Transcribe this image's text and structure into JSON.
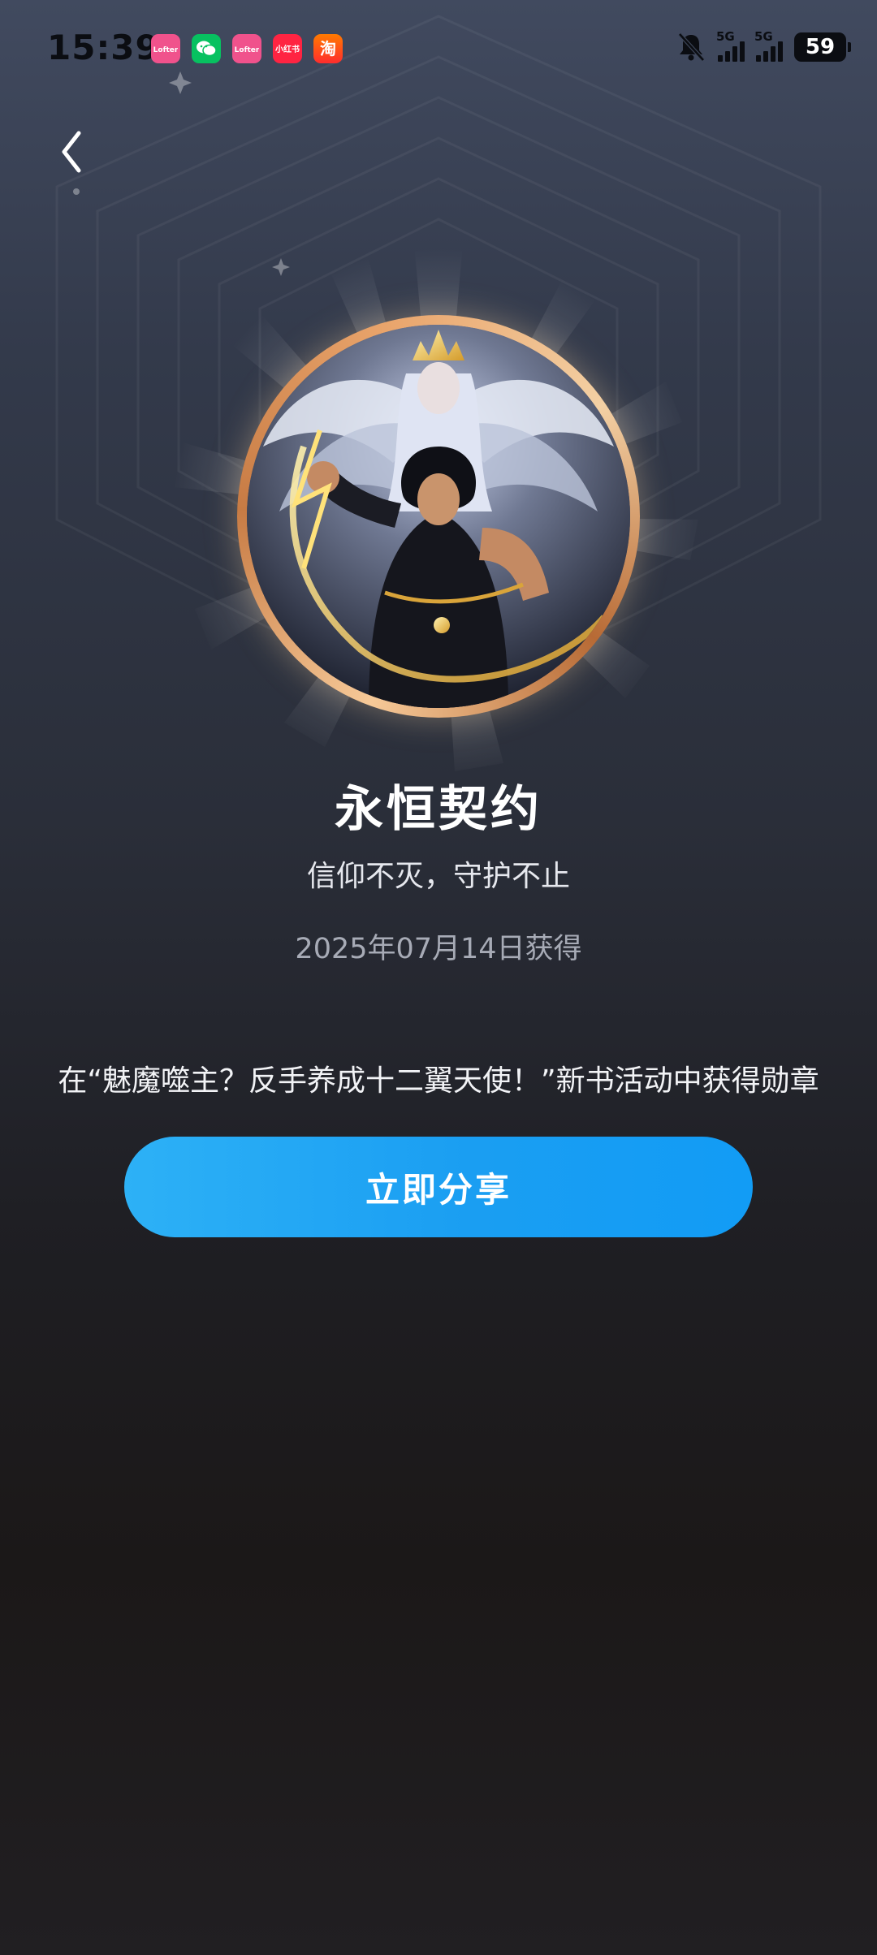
{
  "status_bar": {
    "time": "15:39",
    "apps": [
      {
        "name": "lofter-icon",
        "label": "Lofter",
        "color": "#f0528c"
      },
      {
        "name": "wechat-icon",
        "label": "",
        "color": "#07c160"
      },
      {
        "name": "lofter-icon-2",
        "label": "Lofter",
        "color": "#f0528c"
      },
      {
        "name": "xiaohongshu-icon",
        "label": "小红书",
        "color": "#ff2442"
      },
      {
        "name": "taobao-icon",
        "label": "淘",
        "color": "#ff5000"
      }
    ],
    "network_1": "5G",
    "network_2": "5G",
    "battery": "59"
  },
  "badge": {
    "title": "永恒契约",
    "subtitle": "信仰不灭，守护不止",
    "obtained_date": "2025年07月14日获得",
    "description": "在“魅魔噬主？反手养成十二翼天使！”新书活动中获得勋章"
  },
  "actions": {
    "share_label": "立即分享"
  },
  "colors": {
    "accent": "#1a9ef2",
    "badge_ring": "#e9a46b"
  }
}
